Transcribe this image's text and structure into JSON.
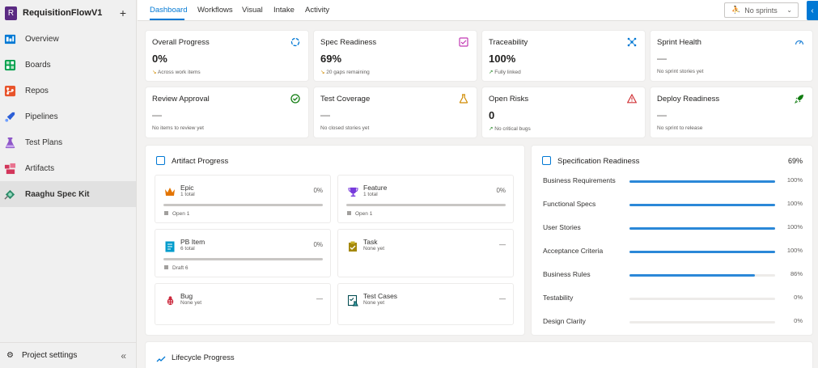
{
  "project": {
    "avatar": "R",
    "name": "RequisitionFlowV1",
    "add": "+"
  },
  "nav": [
    {
      "label": "Overview",
      "icon": "overview-icon",
      "color": "#0078d4"
    },
    {
      "label": "Boards",
      "icon": "boards-icon",
      "color": "#009f4a"
    },
    {
      "label": "Repos",
      "icon": "repos-icon",
      "color": "#e8542b"
    },
    {
      "label": "Pipelines",
      "icon": "pipelines-icon",
      "color": "#2d5fd6"
    },
    {
      "label": "Test Plans",
      "icon": "test-plans-icon",
      "color": "#8e57c8"
    },
    {
      "label": "Artifacts",
      "icon": "artifacts-icon",
      "color": "#d2355a"
    },
    {
      "label": "Raaghu Spec Kit",
      "icon": "spec-kit-icon",
      "color": "#2d8c6a"
    }
  ],
  "footer": {
    "settings": "Project settings",
    "collapse": "«"
  },
  "tabs": [
    "Dashboard",
    "Workflows",
    "Visual",
    "Intake",
    "Activity"
  ],
  "sprint": {
    "label": "No sprints"
  },
  "stats": [
    {
      "title": "Overall Progress",
      "value": "0%",
      "sub": "Across work items",
      "icon": "progress-ring-icon"
    },
    {
      "title": "Spec Readiness",
      "value": "69%",
      "sub": "20 gaps remaining",
      "icon": "checklist-icon"
    },
    {
      "title": "Traceability",
      "value": "100%",
      "sub": "Fully linked",
      "icon": "network-icon"
    },
    {
      "title": "Sprint Health",
      "value": "—",
      "sub": "No sprint stories yet",
      "icon": "gauge-icon"
    },
    {
      "title": "Review Approval",
      "value": "—",
      "sub": "No items to review yet",
      "icon": "check-circle-icon"
    },
    {
      "title": "Test Coverage",
      "value": "—",
      "sub": "No closed stories yet",
      "icon": "flask-icon"
    },
    {
      "title": "Open Risks",
      "value": "0",
      "sub": "No critical bugs",
      "icon": "warning-icon"
    },
    {
      "title": "Deploy Readiness",
      "value": "—",
      "sub": "No sprint to release",
      "icon": "rocket-icon"
    }
  ],
  "artifact": {
    "title": "Artifact Progress",
    "items": [
      {
        "name": "Epic",
        "total": "1 total",
        "pct": "0%",
        "state": "Open 1",
        "icon": "crown-icon"
      },
      {
        "name": "Feature",
        "total": "1 total",
        "pct": "0%",
        "state": "Open 1",
        "icon": "trophy-icon"
      },
      {
        "name": "PB Item",
        "total": "6 total",
        "pct": "0%",
        "state": "Draft 6",
        "icon": "document-icon"
      },
      {
        "name": "Task",
        "total": "None yet",
        "pct": "—",
        "state": "",
        "icon": "task-icon"
      },
      {
        "name": "Bug",
        "total": "None yet",
        "pct": "—",
        "state": "",
        "icon": "bug-icon"
      },
      {
        "name": "Test Cases",
        "total": "None yet",
        "pct": "—",
        "state": "",
        "icon": "test-case-icon"
      }
    ]
  },
  "spec": {
    "title": "Specification Readiness",
    "pct": "69%",
    "rows": [
      {
        "label": "Business Requirements",
        "pct": "100%",
        "value": 100
      },
      {
        "label": "Functional Specs",
        "pct": "100%",
        "value": 100
      },
      {
        "label": "User Stories",
        "pct": "100%",
        "value": 100
      },
      {
        "label": "Acceptance Criteria",
        "pct": "100%",
        "value": 100
      },
      {
        "label": "Business Rules",
        "pct": "86%",
        "value": 86
      },
      {
        "label": "Testability",
        "pct": "0%",
        "value": 0
      },
      {
        "label": "Design Clarity",
        "pct": "0%",
        "value": 0
      }
    ]
  },
  "lifecycle": {
    "title": "Lifecycle Progress"
  }
}
